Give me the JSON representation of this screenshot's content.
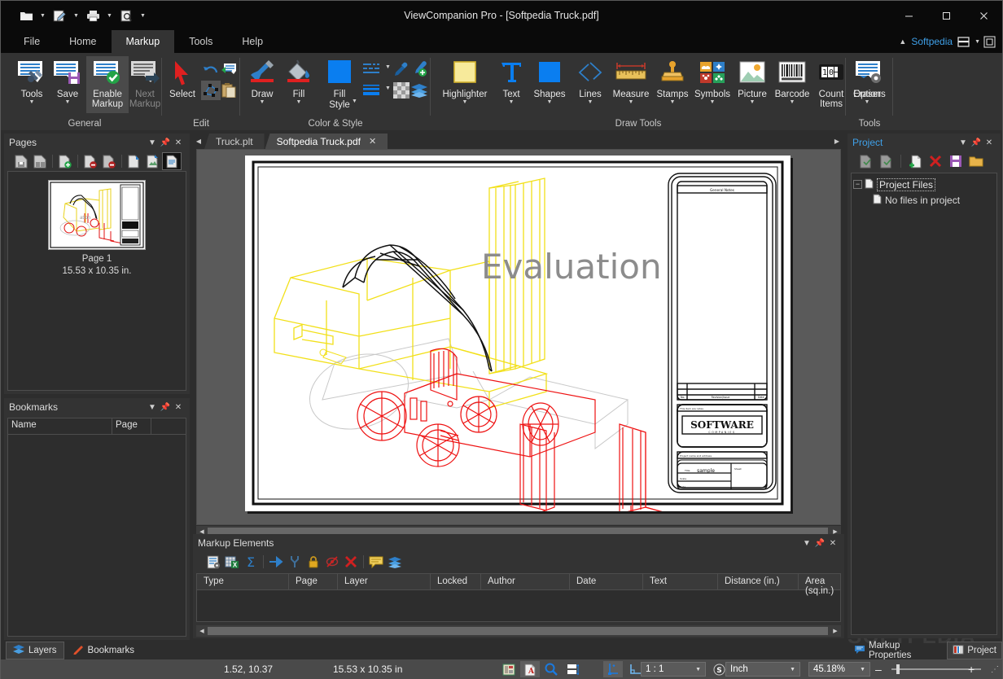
{
  "window": {
    "title": "ViewCompanion Pro - [Softpedia Truck.pdf]",
    "minimize": "–",
    "maximize": "□",
    "close": "✕"
  },
  "quick_access": {
    "items": [
      {
        "name": "open-icon",
        "label": "Open"
      },
      {
        "name": "edit-icon",
        "label": "Edit"
      },
      {
        "name": "print-icon",
        "label": "Print"
      },
      {
        "name": "print-preview-icon",
        "label": "Print Preview"
      }
    ],
    "customize": "⌄"
  },
  "ribbon": {
    "tabs": [
      {
        "label": "File",
        "active": false
      },
      {
        "label": "Home",
        "active": false
      },
      {
        "label": "Markup",
        "active": true
      },
      {
        "label": "Tools",
        "active": false
      },
      {
        "label": "Help",
        "active": false
      }
    ],
    "account": "Softpedia",
    "groups": [
      {
        "title": "General",
        "buttons": [
          {
            "label": "Tools",
            "dropdown": true,
            "selected": false,
            "disabled": false
          },
          {
            "label": "Save",
            "dropdown": true,
            "selected": false,
            "disabled": false
          },
          {
            "label": "Enable\nMarkup",
            "dropdown": false,
            "selected": true,
            "disabled": false
          },
          {
            "label": "Next\nMarkup",
            "dropdown": false,
            "selected": false,
            "disabled": true
          }
        ]
      },
      {
        "title": "Edit",
        "buttons": [
          {
            "label": "Select",
            "dropdown": false,
            "selected": false,
            "disabled": false
          }
        ],
        "small_buttons": [
          "undo-icon",
          "redo-markup-icon",
          "edit-nodes-icon",
          "paste-icon"
        ]
      },
      {
        "title": "Color & Style",
        "buttons": [
          {
            "label": "Draw",
            "dropdown": true,
            "selected": false,
            "disabled": false
          },
          {
            "label": "Fill",
            "dropdown": true,
            "selected": false,
            "disabled": false
          },
          {
            "label": "Fill\nStyle",
            "dropdown": true,
            "selected": false,
            "disabled": false
          }
        ],
        "small_buttons": [
          "line-style-icon",
          "eyedropper-icon",
          "add-color-icon",
          "line-width-icon",
          "transparency-icon",
          "layers-icon"
        ]
      },
      {
        "title": "Draw Tools",
        "buttons": [
          {
            "label": "Highlighter",
            "dropdown": true
          },
          {
            "label": "Text",
            "dropdown": true
          },
          {
            "label": "Shapes",
            "dropdown": true
          },
          {
            "label": "Lines",
            "dropdown": true
          },
          {
            "label": "Measure",
            "dropdown": true
          },
          {
            "label": "Stamps",
            "dropdown": true
          },
          {
            "label": "Symbols",
            "dropdown": true
          },
          {
            "label": "Picture",
            "dropdown": true
          },
          {
            "label": "Barcode",
            "dropdown": true
          },
          {
            "label": "Count\nItems",
            "dropdown": false
          },
          {
            "label": "Eraser",
            "dropdown": true
          }
        ]
      },
      {
        "title": "Tools",
        "buttons": [
          {
            "label": "Options",
            "dropdown": false
          }
        ]
      }
    ]
  },
  "pages_panel": {
    "title": "Pages",
    "toolbar": [
      "save-page-icon",
      "save-all-pages-icon",
      "insert-page-icon",
      "delete-page-icon",
      "delete-pages-icon",
      "extract-icon",
      "export-icon",
      "page-view-icon"
    ],
    "page": {
      "caption": "Page 1",
      "size": "15.53 x 10.35 in."
    }
  },
  "bookmarks_panel": {
    "title": "Bookmarks",
    "columns": [
      "Name",
      "Page",
      ""
    ]
  },
  "left_tabs": [
    {
      "label": "Layers",
      "icon": "layers-icon",
      "active": true
    },
    {
      "label": "Bookmarks",
      "icon": "bookmark-icon",
      "active": false
    }
  ],
  "document_tabs": [
    {
      "label": "Truck.plt",
      "active": false,
      "closable": false
    },
    {
      "label": "Softpedia Truck.pdf",
      "active": true,
      "closable": true
    }
  ],
  "document": {
    "watermark": "Evaluation",
    "titleblock": {
      "general_notes": "General  Notes",
      "revision_no": "No.",
      "revision_label": "Revision/Issue",
      "revision_date": "Date",
      "company_header": "This item are notes",
      "company_name": "SOFTWARE",
      "company_sub": "C O M P A N I E S",
      "project_header": "Project name and address",
      "sample_title": "sample",
      "sheet_label": "Sheet"
    }
  },
  "markup_panel": {
    "title": "Markup Elements",
    "toolbar": [
      "properties-icon",
      "export-excel-icon",
      "sum-icon",
      "goto-icon",
      "settings-icon",
      "lock-icon",
      "hide-icon",
      "delete-icon",
      "comment-icon",
      "layers-icon"
    ],
    "columns": [
      "Type",
      "Page",
      "Layer",
      "Locked",
      "Author",
      "Date",
      "Text",
      "Distance (in.)",
      "Area (sq.in.)"
    ],
    "rows": []
  },
  "project_panel": {
    "title": "Project",
    "toolbar": [
      "open-project-icon",
      "save-project-icon",
      "add-file-icon",
      "remove-file-icon",
      "save-icon",
      "folder-icon"
    ],
    "tree": {
      "root": "Project Files",
      "child": "No files in project"
    }
  },
  "right_tabs": [
    {
      "label": "Markup Properties",
      "icon": "comment-icon",
      "active": false
    },
    {
      "label": "Project",
      "icon": "project-icon",
      "active": true
    }
  ],
  "watermark_brand": "SOFTPEDIA",
  "statusbar": {
    "coordinates": "1.52, 10.37",
    "page_size": "15.53 x 10.35 in",
    "view_buttons": [
      "thumbnail-icon",
      "pdf-icon",
      "zoom-icon",
      "fit-icon"
    ],
    "tool_buttons": [
      "measure-tool-icon",
      "corner-tool-icon"
    ],
    "scale": "1 : 1",
    "scale_icon": "scale-icon",
    "unit": "Inch",
    "zoom": "45.18%",
    "zoom_out": "–",
    "zoom_in": "+",
    "resize_grip": "⋰"
  }
}
